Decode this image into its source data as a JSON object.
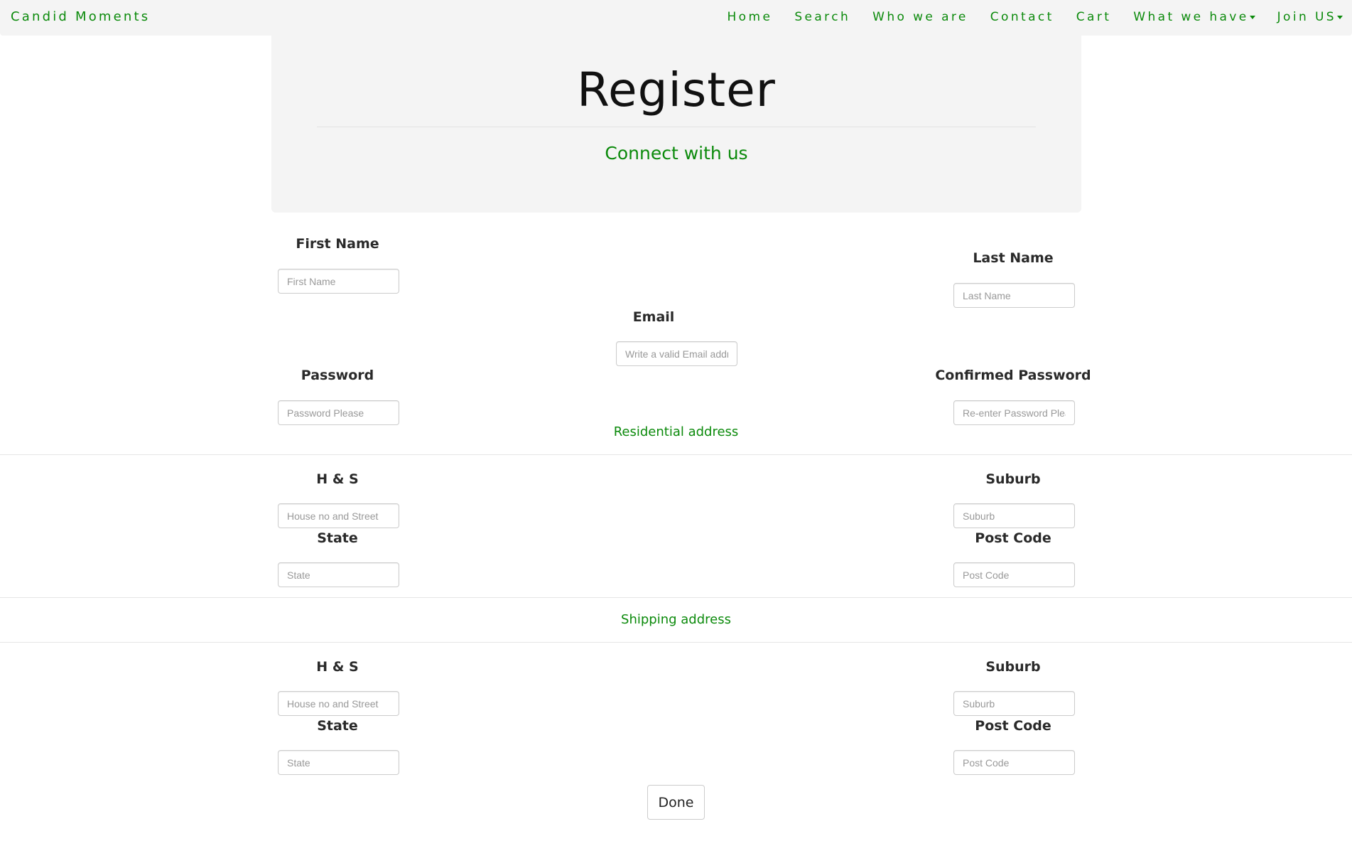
{
  "navbar": {
    "brand": "Candid Moments",
    "links": [
      "Home",
      "Search",
      "Who we are",
      "Contact",
      "Cart",
      "What we have",
      "Join US"
    ],
    "accent_color": "#0b8a0b"
  },
  "header": {
    "title": "Register",
    "subtitle": "Connect with us"
  },
  "form": {
    "first_name": {
      "label": "First Name",
      "placeholder": "First Name"
    },
    "last_name": {
      "label": "Last Name",
      "placeholder": "Last Name"
    },
    "email": {
      "label": "Email",
      "placeholder": "Write a valid Email address"
    },
    "password": {
      "label": "Password",
      "placeholder": "Password Please"
    },
    "confirm_password": {
      "label": "Confirmed Password",
      "placeholder": "Re-enter Password Please"
    },
    "residential": {
      "title": "Residential address",
      "hs": {
        "label": "H & S",
        "placeholder": "House no and Street"
      },
      "suburb": {
        "label": "Suburb",
        "placeholder": "Suburb"
      },
      "state": {
        "label": "State",
        "placeholder": "State"
      },
      "postcode": {
        "label": "Post Code",
        "placeholder": "Post Code"
      }
    },
    "shipping": {
      "title": "Shipping address",
      "hs": {
        "label": "H & S",
        "placeholder": "House no and Street"
      },
      "suburb": {
        "label": "Suburb",
        "placeholder": "Suburb"
      },
      "state": {
        "label": "State",
        "placeholder": "State"
      },
      "postcode": {
        "label": "Post Code",
        "placeholder": "Post Code"
      }
    },
    "submit_label": "Done"
  }
}
